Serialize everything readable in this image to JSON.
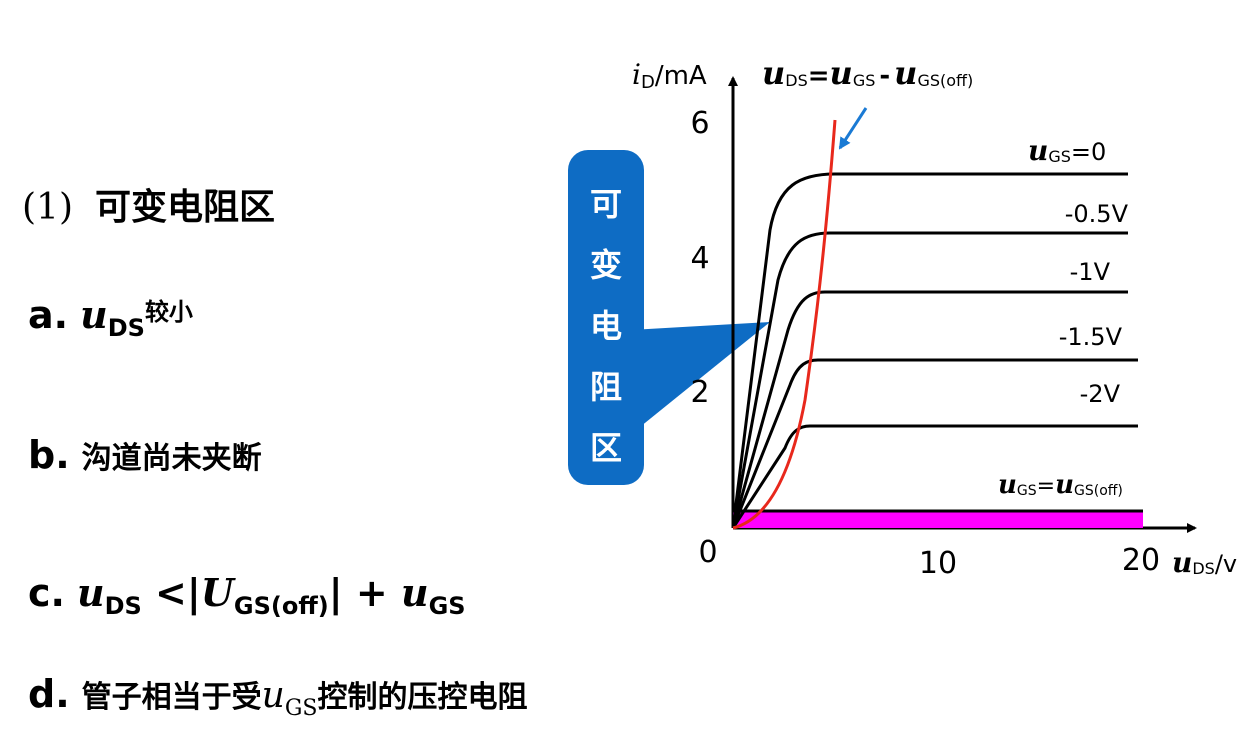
{
  "slide": {
    "heading_num": "(1)",
    "heading_text": "可变电阻区",
    "items": [
      {
        "label": "a.",
        "u": "u",
        "sub": "DS",
        "text": "较小"
      },
      {
        "label": "b.",
        "text": "沟道尚未夹断"
      },
      {
        "label": "c.",
        "u1": "u",
        "sub1": "DS",
        "lt": " <|",
        "U2": "U",
        "sub2": "GS(off)",
        "plus": "| + ",
        "u3": "u",
        "sub3": "GS"
      },
      {
        "label": "d.",
        "pre": "管子相当于受",
        "u": "u",
        "sub": "GS",
        "post": "控制的压控电阻"
      }
    ]
  },
  "callout": {
    "chars": [
      "可",
      "变",
      "电",
      "阻",
      "区"
    ],
    "color": "#0e6cc4"
  },
  "diagram": {
    "y_axis_label": {
      "i": "i",
      "sub": "D",
      "unit": "/mA"
    },
    "x_axis_label": {
      "u": "u",
      "sub": "DS",
      "unit": "/v"
    },
    "y_ticks": [
      "6",
      "4",
      "2"
    ],
    "origin": "0",
    "x_ticks": [
      "10",
      "20"
    ],
    "boundary_label": {
      "u1": "u",
      "s1": "DS",
      "eq": "=",
      "u2": "u",
      "s2": "GS",
      "minus": "-",
      "u3": "u",
      "s3": "GS(off)"
    },
    "curve_labels": [
      {
        "u": "u",
        "sub": "GS",
        "rest": "=0"
      },
      {
        "text": "-0.5V"
      },
      {
        "text": "-1V"
      },
      {
        "text": "-1.5V"
      },
      {
        "text": "-2V"
      }
    ],
    "cutoff_label": {
      "u1": "u",
      "s1": "GS",
      "eq": "=",
      "u2": "u",
      "s2": "GS(off)"
    },
    "curve_color": "#000000",
    "boundary_color": "#e8281c",
    "cutoff_color": "#ff00ff",
    "arrow_color": "#1a7ad4"
  }
}
